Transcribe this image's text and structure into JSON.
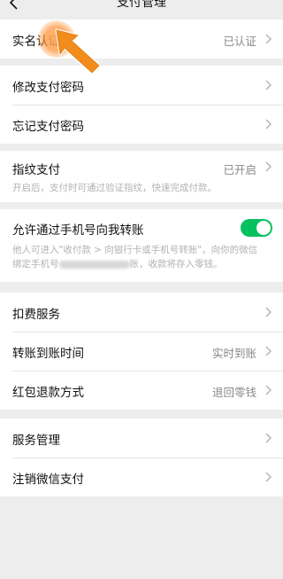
{
  "header": {
    "title": "支付管理"
  },
  "group1": {
    "realname": {
      "label": "实名认证",
      "value": "已认证"
    }
  },
  "group2": {
    "change_pwd": {
      "label": "修改支付密码"
    },
    "forgot_pwd": {
      "label": "忘记支付密码"
    }
  },
  "group3": {
    "fingerprint": {
      "label": "指纹支付",
      "value": "已开启",
      "desc": "开启后，支付时可通过验证指纹，快速完成付款。"
    }
  },
  "group4": {
    "phone_transfer": {
      "label": "允许通过手机号向我转账",
      "toggle_on": true,
      "desc_line1": "他人可进入\"收付款 > 向银行卡或手机号转账\"，向你的微信",
      "desc_line2_prefix": "绑定手机号",
      "desc_line2_suffix": "账，收款将存入零钱。"
    }
  },
  "group5": {
    "deduction": {
      "label": "扣费服务"
    },
    "arrival_time": {
      "label": "转账到账时间",
      "value": "实时到账"
    },
    "refund": {
      "label": "红包退款方式",
      "value": "退回零钱"
    }
  },
  "group6": {
    "service_mgmt": {
      "label": "服务管理"
    },
    "cancel_pay": {
      "label": "注销微信支付"
    }
  },
  "colors": {
    "accent": "#07c160",
    "background": "#ededed",
    "hint": "#ff9a3c"
  }
}
